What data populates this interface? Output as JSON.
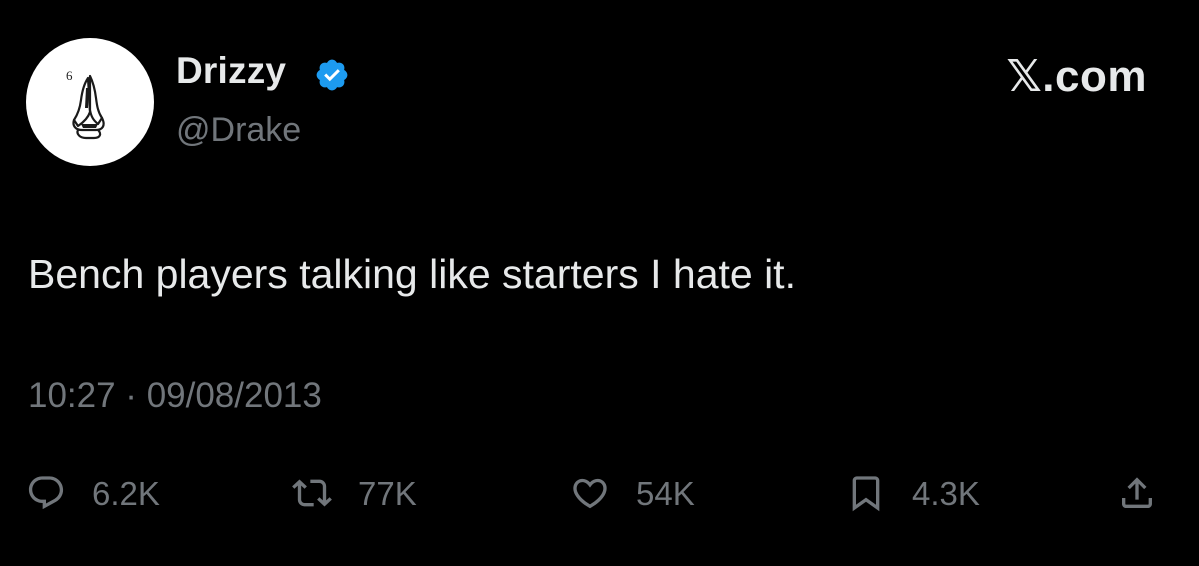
{
  "author": {
    "display_name": "Drizzy",
    "handle": "@Drake",
    "avatar_icon": "praying-hands-icon",
    "avatar_numeral": "6",
    "verified": true,
    "verified_color": "#1d9bf0"
  },
  "brand": {
    "label": "𝕏.com"
  },
  "tweet": {
    "text": "Bench players talking like starters I hate it.",
    "timestamp": "10:27 · 09/08/2013"
  },
  "actions": {
    "reply": {
      "icon": "reply-icon",
      "count": "6.2K"
    },
    "repost": {
      "icon": "repost-icon",
      "count": "77K"
    },
    "like": {
      "icon": "heart-icon",
      "count": "54K"
    },
    "bookmark": {
      "icon": "bookmark-icon",
      "count": "4.3K"
    },
    "share": {
      "icon": "share-icon"
    }
  },
  "colors": {
    "background": "#000000",
    "primary_text": "#e7e9ea",
    "secondary_text": "#71767b"
  }
}
